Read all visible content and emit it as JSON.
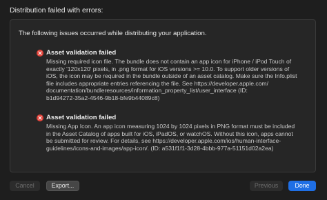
{
  "dialog": {
    "title": "Distribution failed with errors:",
    "intro": "The following issues occurred while distributing your application."
  },
  "issues": [
    {
      "title": "Asset validation failed",
      "icon": "error-icon",
      "text": "Missing required icon file. The bundle does not contain an app icon for iPhone / iPod Touch of\nexactly '120x120' pixels, in .png format for iOS versions >= 10.0. To support older versions of\niOS, the icon may be required in the bundle outside of an asset catalog. Make sure the Info.plist\nfile includes appropriate entries referencing the file. See https://developer.apple.com/\ndocumentation/bundleresources/information_property_list/user_interface (ID:\nb1d94272-35a2-4546-9b18-bfe9b44089c8)"
    },
    {
      "title": "Asset validation failed",
      "icon": "error-icon",
      "text": "Missing App Icon. An app icon measuring 1024 by 1024 pixels in PNG format must be included\nin the Asset Catalog of apps built for iOS, iPadOS, or watchOS. Without this icon, apps cannot\nbe submitted for review. For details, see https://developer.apple.com/ios/human-interface-\nguidelines/icons-and-images/app-icon/. (ID: a531f1f1-3d28-4bbb-977a-51151d02a2ea)"
    }
  ],
  "buttons": {
    "cancel": "Cancel",
    "export": "Export...",
    "previous": "Previous",
    "done": "Done"
  },
  "colors": {
    "error": "#e2443b",
    "accent": "#1f6fe5"
  }
}
